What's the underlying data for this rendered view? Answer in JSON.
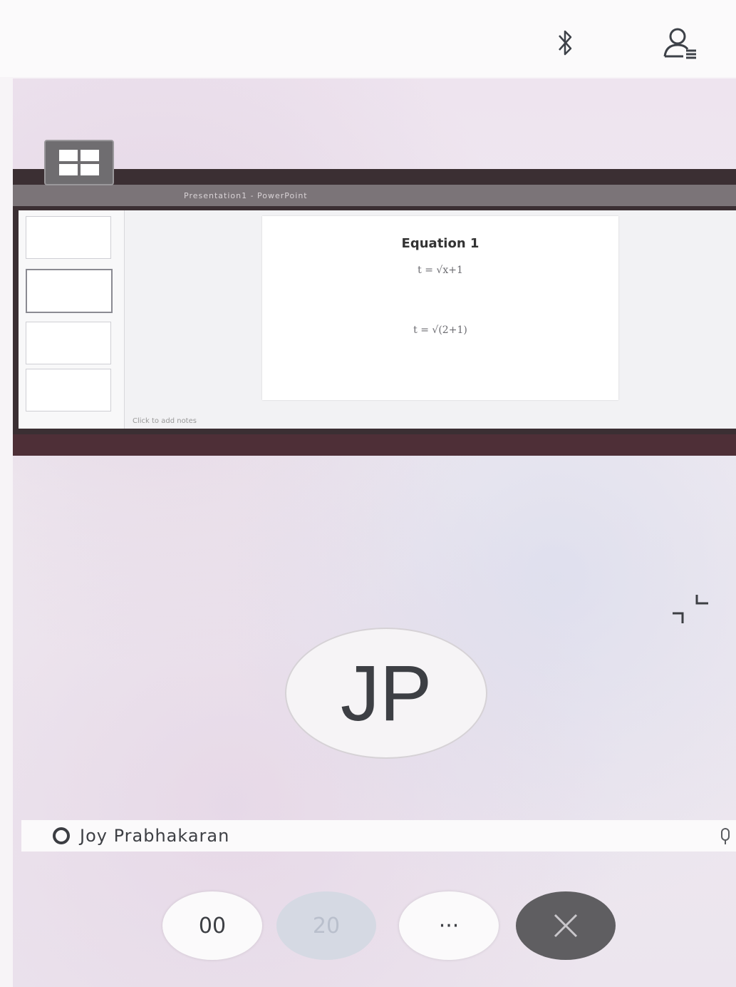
{
  "topbar": {
    "bluetooth_icon": "bluetooth-icon",
    "participants_icon": "participants-icon"
  },
  "layout_button_icon": "grid-layout-icon",
  "shared_screen": {
    "titlebar_text": "Presentation1 - PowerPoint",
    "slide": {
      "title": "Equation 1",
      "formula_1": "t = √x+1",
      "formula_2": "t = √(2+1)"
    },
    "notes_text": "Click to add notes"
  },
  "exit_fullscreen_icon": "exit-fullscreen-icon",
  "participant": {
    "initials": "JP",
    "name": "Joy Prabhakaran",
    "mic_icon": "microphone-icon"
  },
  "controls": {
    "mute_label": "00",
    "video_label": "20",
    "more_label": "···",
    "hangup_icon": "hang-up-icon"
  },
  "colors": {
    "hangup": "#5f5e61",
    "frame": "#3b2f33",
    "text": "#3d3f44"
  }
}
